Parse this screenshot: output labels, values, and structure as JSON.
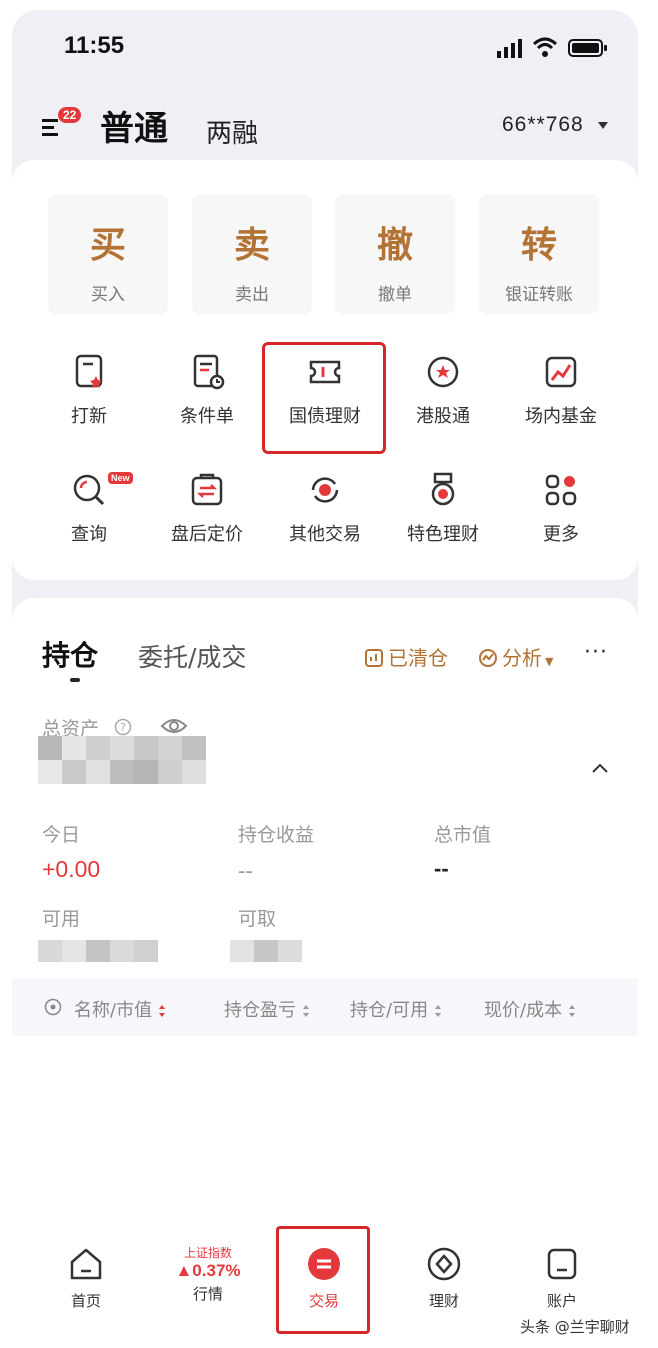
{
  "status_bar": {
    "time": "11:55"
  },
  "header": {
    "menu_badge": "22",
    "tab_active": "普通",
    "tab_inactive": "两融",
    "account": "66**768"
  },
  "quick_actions": [
    {
      "big": "买",
      "small": "买入"
    },
    {
      "big": "卖",
      "small": "卖出"
    },
    {
      "big": "撤",
      "small": "撤单"
    },
    {
      "big": "转",
      "small": "银证转账"
    }
  ],
  "grid": [
    {
      "label": "打新",
      "icon": "certificate-icon"
    },
    {
      "label": "条件单",
      "icon": "conditional-order-icon"
    },
    {
      "label": "国债理财",
      "icon": "ticket-icon"
    },
    {
      "label": "港股通",
      "icon": "hk-flower-icon"
    },
    {
      "label": "场内基金",
      "icon": "fund-chart-icon"
    },
    {
      "label": "查询",
      "icon": "query-icon",
      "tag": "New"
    },
    {
      "label": "盘后定价",
      "icon": "exchange-bag-icon"
    },
    {
      "label": "其他交易",
      "icon": "refresh-yen-icon"
    },
    {
      "label": "特色理财",
      "icon": "medal-icon"
    },
    {
      "label": "更多",
      "icon": "apps-icon"
    }
  ],
  "positions": {
    "tab_active": "持仓",
    "tab_inactive": "委托/成交",
    "cleared": "已清仓",
    "analysis": "分析",
    "more": "···",
    "total_assets_label": "总资产",
    "today_label": "今日",
    "today_value": "+0.00",
    "holding_profit_label": "持仓收益",
    "holding_profit_value": "--",
    "market_value_label": "总市值",
    "market_value_value": "--",
    "available_label": "可用",
    "withdrawable_label": "可取"
  },
  "table_header": {
    "col1": "名称/市值",
    "col2": "持仓盈亏",
    "col3": "持仓/可用",
    "col4": "现价/成本"
  },
  "tabbar": {
    "home": "首页",
    "market_index_name": "上证指数",
    "market_index_value": "▲0.37%",
    "market": "行情",
    "trade": "交易",
    "wealth": "理财",
    "account": "账户"
  },
  "watermark": "头条 @兰宇聊财",
  "colors": {
    "accent_brown": "#b27334",
    "red": "#e4393c",
    "highlight_box": "#d62828"
  }
}
